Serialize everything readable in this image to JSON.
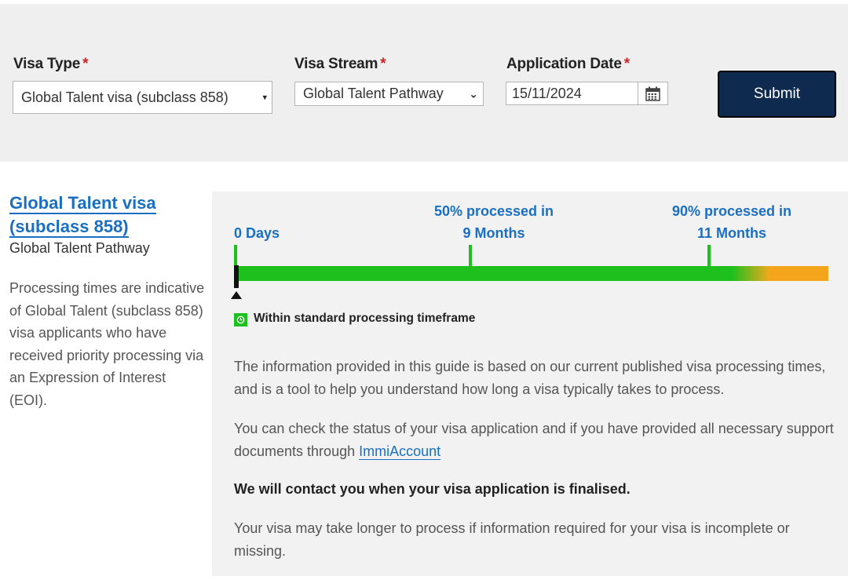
{
  "form": {
    "visa_type": {
      "label": "Visa Type",
      "required_mark": "*",
      "value": "Global Talent visa (subclass 858)"
    },
    "visa_stream": {
      "label": "Visa Stream",
      "required_mark": "*",
      "value": "Global Talent Pathway"
    },
    "application_date": {
      "label": "Application Date",
      "required_mark": "*",
      "value": "15/11/2024"
    },
    "submit_label": "Submit"
  },
  "result": {
    "visa_title_line1": "Global Talent visa",
    "visa_title_line2": "(subclass 858)",
    "stream_name": "Global Talent Pathway",
    "note": "Processing times are indicative of Global Talent (subclass 858) visa applicants who have received priority processing via an Expression of Interest (EOI)."
  },
  "timeline": {
    "start": {
      "line1": "0 Days"
    },
    "p50": {
      "line1": "50% processed in",
      "line2": "9 Months"
    },
    "p90": {
      "line1": "90% processed in",
      "line2": "11 Months"
    },
    "percent_elapsed": 0,
    "legend": "Within standard processing timeframe"
  },
  "info": {
    "p1": "The information provided in this guide is based on our current published visa processing times, and is a tool to help you understand how long a visa typically takes to process.",
    "p2_before_link": "You can check the status of your visa application and if you have provided all necessary support documents through ",
    "p2_link": "ImmiAccount",
    "p3": "We will contact you when your visa application is finalised.",
    "p4": "Your visa may take longer to process if information required for your visa is incomplete or missing."
  },
  "colors": {
    "primary_blue": "#1a6fc2",
    "submit_bg": "#0e2a4e",
    "within_green": "#1ec01e",
    "beyond_orange": "#f4a51c",
    "required_red": "#d31f1f"
  }
}
